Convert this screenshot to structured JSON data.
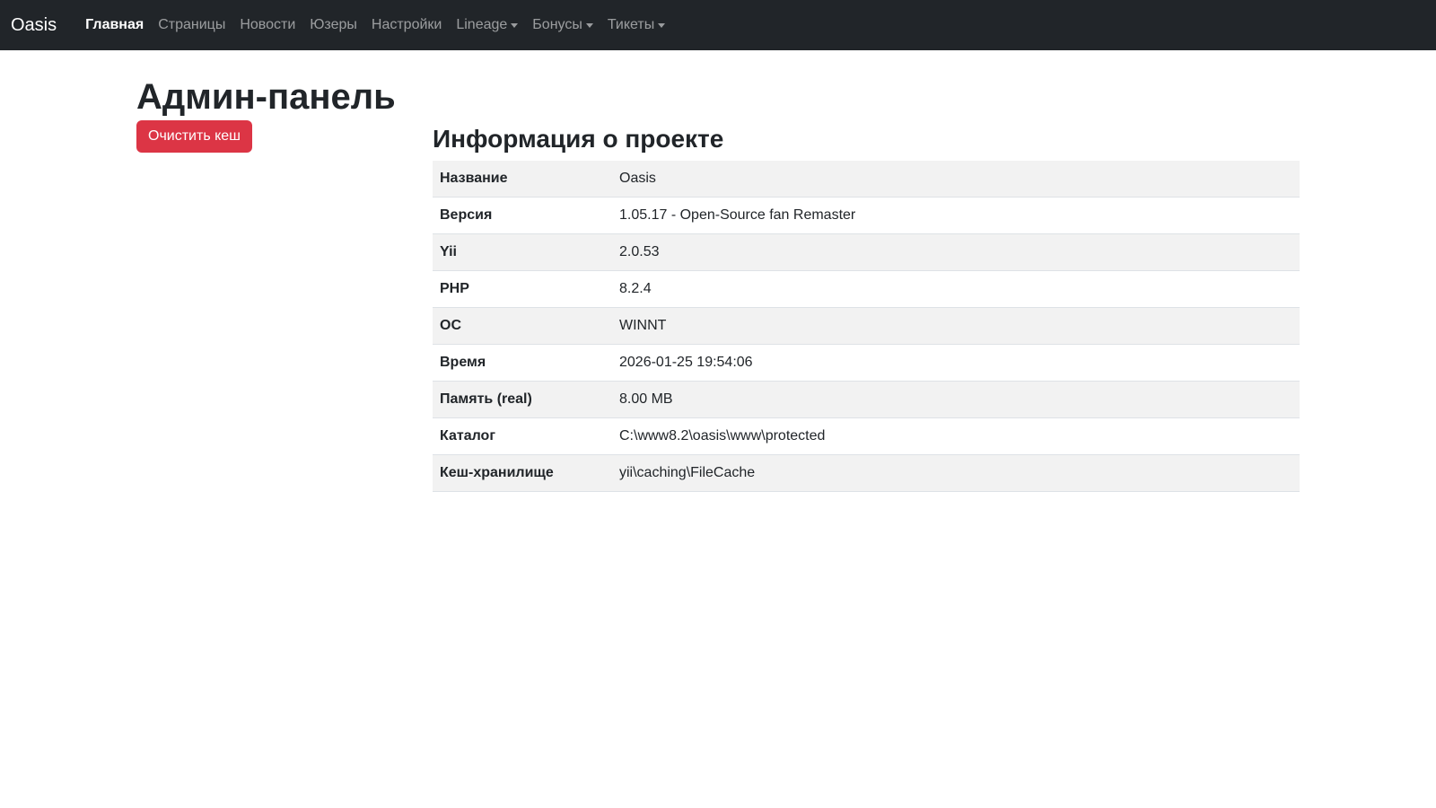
{
  "navbar": {
    "brand": "Oasis",
    "items": [
      {
        "label": "Главная",
        "active": true,
        "dropdown": false
      },
      {
        "label": "Страницы",
        "active": false,
        "dropdown": false
      },
      {
        "label": "Новости",
        "active": false,
        "dropdown": false
      },
      {
        "label": "Юзеры",
        "active": false,
        "dropdown": false
      },
      {
        "label": "Настройки",
        "active": false,
        "dropdown": false
      },
      {
        "label": "Lineage",
        "active": false,
        "dropdown": true
      },
      {
        "label": "Бонусы",
        "active": false,
        "dropdown": true
      },
      {
        "label": "Тикеты",
        "active": false,
        "dropdown": true
      }
    ]
  },
  "page": {
    "title": "Админ-панель",
    "clear_cache_label": "Очистить кеш"
  },
  "info": {
    "title": "Информация о проекте",
    "rows": [
      {
        "key": "Название",
        "value": "Oasis"
      },
      {
        "key": "Версия",
        "value": "1.05.17 - Open-Source fan Remaster"
      },
      {
        "key": "Yii",
        "value": "2.0.53"
      },
      {
        "key": "PHP",
        "value": "8.2.4"
      },
      {
        "key": "ОС",
        "value": "WINNT"
      },
      {
        "key": "Время",
        "value": "2026-01-25 19:54:06"
      },
      {
        "key": "Память (real)",
        "value": "8.00 MB"
      },
      {
        "key": "Каталог",
        "value": "C:\\www8.2\\oasis\\www\\protected"
      },
      {
        "key": "Кеш-хранилище",
        "value": "yii\\caching\\FileCache"
      }
    ]
  },
  "colors": {
    "navbar_bg": "#212529",
    "danger": "#dc3545",
    "stripe": "#f2f2f2"
  }
}
